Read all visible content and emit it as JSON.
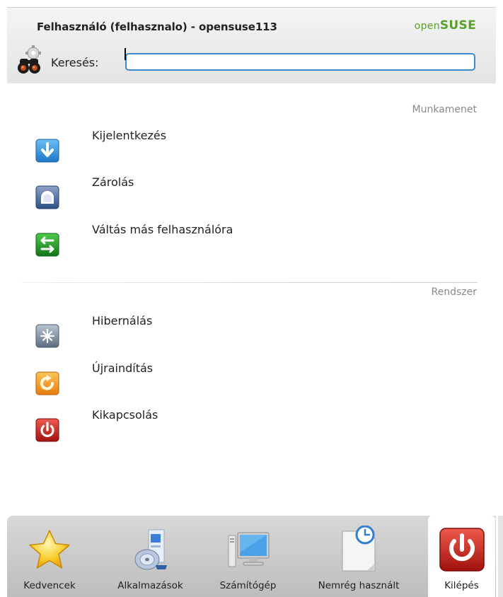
{
  "header": {
    "user_title": "Felhasználó (felhasznalo) - opensuse113",
    "logo_open": "open",
    "logo_suse": "SUSE",
    "search_label": "Keresés:",
    "search_value": "",
    "search_icon": "binoculars-gear-icon"
  },
  "session": {
    "heading": "Munkamenet",
    "items": [
      {
        "label": "Kijelentkezés",
        "icon": "logout-arrow-icon"
      },
      {
        "label": "Zárolás",
        "icon": "lock-icon"
      },
      {
        "label": "Váltás más felhasználóra",
        "icon": "switch-user-icon"
      }
    ]
  },
  "system": {
    "heading": "Rendszer",
    "items": [
      {
        "label": "Hibernálás",
        "icon": "hibernate-icon"
      },
      {
        "label": "Újraindítás",
        "icon": "restart-icon"
      },
      {
        "label": "Kikapcsolás",
        "icon": "shutdown-icon"
      }
    ]
  },
  "tabs": [
    {
      "label": "Kedvencek",
      "icon": "star-icon"
    },
    {
      "label": "Alkalmazások",
      "icon": "applications-icon"
    },
    {
      "label": "Számítógép",
      "icon": "computer-icon"
    },
    {
      "label": "Nemrég használt",
      "icon": "recent-documents-icon"
    },
    {
      "label": "Kilépés",
      "icon": "power-icon",
      "active": true
    }
  ],
  "colors": {
    "accent_green": "#5ba02b",
    "search_border": "#3d8ad0",
    "logout_blue": "#2f8fd8",
    "switch_green": "#1f9a2a",
    "restart_orange": "#f29a1c",
    "shutdown_red": "#c82020"
  }
}
